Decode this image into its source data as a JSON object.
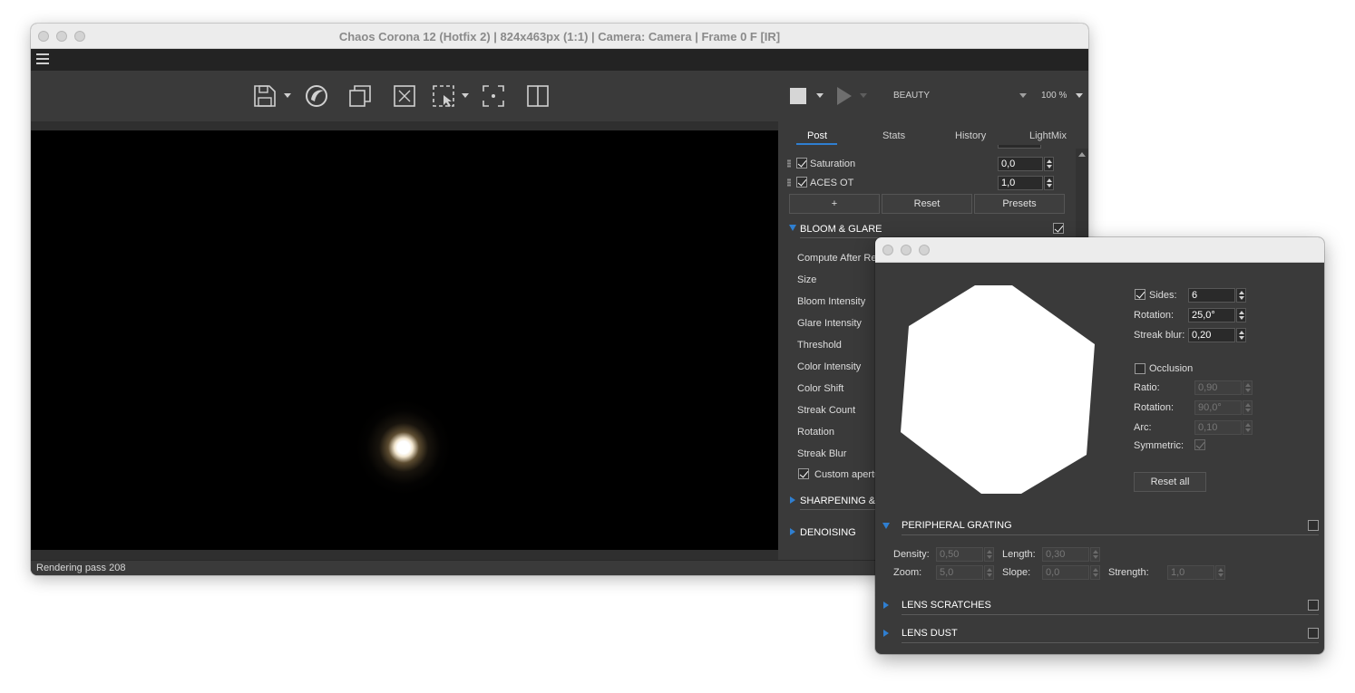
{
  "main_window": {
    "title": "Chaos Corona 12 (Hotfix 2) | 824x463px (1:1) | Camera: Camera | Frame 0 F [IR]",
    "status": "Rendering pass 208",
    "render_pass_selector": "BEAUTY",
    "zoom": "100 %",
    "tabs": [
      "Post",
      "Stats",
      "History",
      "LightMix"
    ],
    "active_tab": "Post",
    "tonemapping": {
      "saturation_label": "Saturation",
      "saturation_value": "0,0",
      "aces_label": "ACES OT",
      "aces_value": "1,0",
      "add_label": "+",
      "reset_label": "Reset",
      "presets_label": "Presets"
    },
    "bloom_glare": {
      "title": "BLOOM & GLARE",
      "params": [
        "Compute After Re",
        "Size",
        "Bloom Intensity",
        "Glare Intensity",
        "Threshold",
        "Color Intensity",
        "Color Shift",
        "Streak Count",
        "Rotation",
        "Streak Blur"
      ],
      "custom_aperture_label": "Custom apertu"
    },
    "sharpening_title": "SHARPENING & B",
    "denoising_title": "DENOISING"
  },
  "aperture_window": {
    "sides_label": "Sides:",
    "sides_value": "6",
    "rotation_label": "Rotation:",
    "rotation_value": "25,0°",
    "streak_blur_label": "Streak blur:",
    "streak_blur_value": "0,20",
    "occlusion_label": "Occlusion",
    "ratio_label": "Ratio:",
    "ratio_value": "0,90",
    "occ_rotation_label": "Rotation:",
    "occ_rotation_value": "90,0°",
    "arc_label": "Arc:",
    "arc_value": "0,10",
    "symmetric_label": "Symmetric:",
    "reset_all_label": "Reset all",
    "peripheral_grating": {
      "title": "PERIPHERAL GRATING",
      "density_label": "Density:",
      "density_value": "0,50",
      "length_label": "Length:",
      "length_value": "0,30",
      "zoom_label": "Zoom:",
      "zoom_value": "5,0",
      "slope_label": "Slope:",
      "slope_value": "0,0",
      "strength_label": "Strength:",
      "strength_value": "1,0"
    },
    "lens_scratches_title": "LENS SCRATCHES",
    "lens_dust_title": "LENS DUST"
  },
  "icons": [
    "hamburger-icon",
    "save-icon",
    "corona-logo-icon",
    "copy-icon",
    "clear-icon",
    "region-select-icon",
    "focus-point-icon",
    "split-view-icon",
    "stop-icon",
    "play-icon"
  ]
}
